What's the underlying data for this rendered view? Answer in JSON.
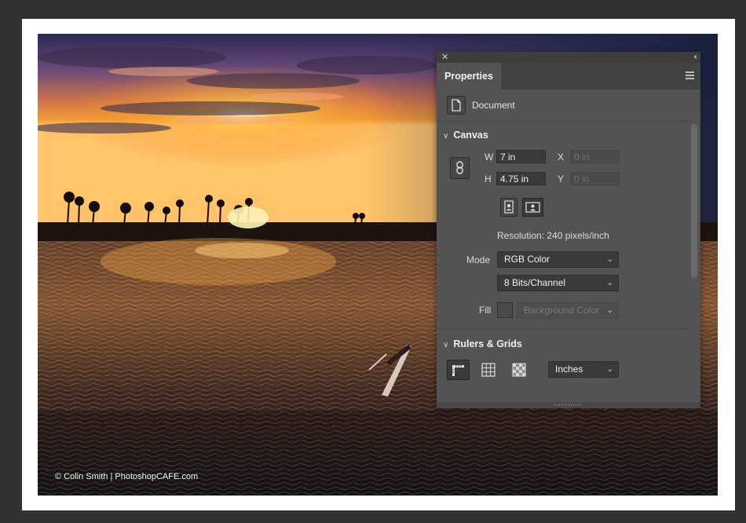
{
  "photo": {
    "credit": "© Colin Smith | PhotoshopCAFE.com"
  },
  "panel": {
    "tab_label": "Properties",
    "document_label": "Document",
    "canvas": {
      "heading": "Canvas",
      "w_label": "W",
      "w_value": "7 in",
      "h_label": "H",
      "h_value": "4.75 in",
      "x_label": "X",
      "x_value": "0 in",
      "y_label": "Y",
      "y_value": "0 in",
      "resolution": "Resolution: 240 pixels/inch",
      "mode_label": "Mode",
      "mode_value": "RGB Color",
      "bits_value": "8 Bits/Channel",
      "fill_label": "Fill",
      "fill_value": "Background Color"
    },
    "rulers": {
      "heading": "Rulers & Grids",
      "units_value": "Inches"
    }
  },
  "icons": {
    "close": "close-icon",
    "collapse": "double-chevron-icon",
    "menu": "panel-menu-icon",
    "document": "document-icon",
    "link": "link-icon",
    "portrait": "portrait-orientation-icon",
    "landscape": "landscape-orientation-icon",
    "ruler": "ruler-icon",
    "grid": "grid-icon",
    "transparency": "transparency-grid-icon"
  },
  "colors": {
    "panel_bg": "#535353",
    "field_bg": "#3a3a3a",
    "paper": "#ffffff"
  }
}
